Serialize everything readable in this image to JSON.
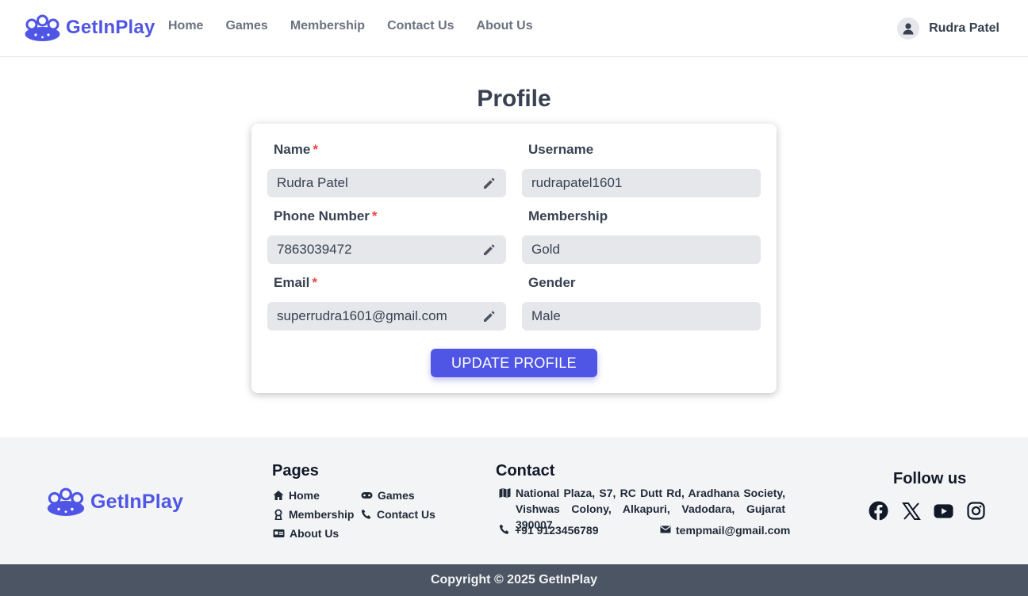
{
  "brand": {
    "name": "GetInPlay",
    "color": "#4f56e5"
  },
  "nav": {
    "items": [
      {
        "label": "Home"
      },
      {
        "label": "Games"
      },
      {
        "label": "Membership"
      },
      {
        "label": "Contact Us"
      },
      {
        "label": "About Us"
      }
    ]
  },
  "user": {
    "name": "Rudra Patel",
    "icon": "user-icon"
  },
  "profile": {
    "title": "Profile",
    "fields": {
      "name": {
        "label": "Name",
        "required": "*",
        "value": "Rudra Patel",
        "editable": true
      },
      "username": {
        "label": "Username",
        "value": "rudrapatel1601",
        "editable": false
      },
      "phone": {
        "label": "Phone Number",
        "required": "*",
        "value": "7863039472",
        "editable": true
      },
      "membership": {
        "label": "Membership",
        "value": "Gold",
        "editable": false
      },
      "email": {
        "label": "Email",
        "required": "*",
        "value": "superrudra1601@gmail.com",
        "editable": true
      },
      "gender": {
        "label": "Gender",
        "value": "Male",
        "editable": false
      }
    },
    "update_button": "UPDATE PROFILE"
  },
  "footer": {
    "pages": {
      "heading": "Pages",
      "links": [
        {
          "label": "Home",
          "icon": "home-icon"
        },
        {
          "label": "Games",
          "icon": "gamepad-icon"
        },
        {
          "label": "Membership",
          "icon": "award-icon"
        },
        {
          "label": "Contact Us",
          "icon": "phone-icon"
        },
        {
          "label": "About Us",
          "icon": "id-card-icon"
        }
      ]
    },
    "contact": {
      "heading": "Contact",
      "address": "National Plaza, S7, RC Dutt Rd, Aradhana Society, Vishwas Colony, Alkapuri, Vadodara, Gujarat 390007",
      "phone": "+91 9123456789",
      "email": "tempmail@gmail.com"
    },
    "follow": {
      "heading": "Follow us",
      "icons": [
        "facebook-icon",
        "x-icon",
        "youtube-icon",
        "instagram-icon"
      ]
    },
    "copyright": "Copyright © 2025 GetInPlay"
  }
}
